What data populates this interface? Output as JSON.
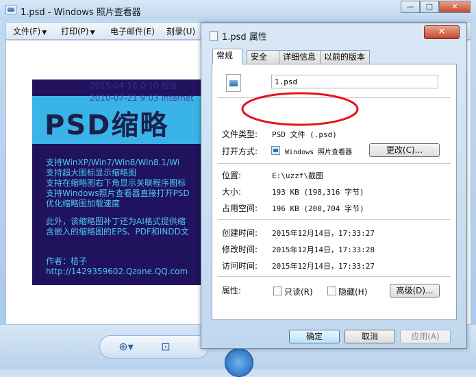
{
  "viewer": {
    "title": "1.psd - Windows 照片查看器",
    "window_buttons": {
      "minimize": "—",
      "maximize": "□",
      "close": "✕"
    },
    "menu": [
      {
        "label": "文件(F)"
      },
      {
        "label": "打印(P)"
      },
      {
        "label": "电子邮件(E)"
      },
      {
        "label": "刻录(U)"
      }
    ],
    "preview": {
      "date1": "2015-04-16 0:10    包含",
      "date2": "2010-07-21 9:03    Internet",
      "big_text": "PSD缩略",
      "lines": [
        "支持WinXP/Win7/Win8/Win8.1/Wi",
        "支持超大图标显示缩略图",
        "支持在缩略图右下角显示关联程序图标",
        "支持Windows照片查看器直接打开PSD",
        "优化缩略图加载速度"
      ],
      "extra": [
        "此外，该缩略图补丁还为AI格式提供缩",
        "含嵌入的缩略图的EPS、PDF和INDD文"
      ],
      "author": [
        "作者：桔子",
        "http://1429359602.Qzone.QQ.com"
      ]
    },
    "controls": {
      "zoom_icon": "zoom-icon",
      "fit_icon": "fit-window-icon"
    }
  },
  "dialog": {
    "title": "1.psd 属性",
    "close_label": "✕",
    "tabs": [
      "常规",
      "安全",
      "详细信息",
      "以前的版本"
    ],
    "filename": "1.psd",
    "rows": {
      "type_label": "文件类型:",
      "type_value": "PSD 文件 (.psd)",
      "opener_label": "打开方式:",
      "opener_value": "Windows 照片查看器",
      "change_button": "更改(C)...",
      "location_label": "位置:",
      "location_value": "E:\\uzzf\\截图",
      "size_label": "大小:",
      "size_value": "193 KB (198,316 字节)",
      "disk_label": "占用空间:",
      "disk_value": "196 KB (200,704 字节)",
      "created_label": "创建时间:",
      "created_value": "2015年12月14日，17:33:27",
      "modified_label": "修改时间:",
      "modified_value": "2015年12月14日，17:33:28",
      "accessed_label": "访问时间:",
      "accessed_value": "2015年12月14日，17:33:27",
      "attr_label": "属性:",
      "readonly_label": "只读(R)",
      "hidden_label": "隐藏(H)",
      "advanced_button": "高级(D)..."
    },
    "buttons": {
      "ok": "确定",
      "cancel": "取消",
      "apply": "应用(A)"
    }
  },
  "colors": {
    "annotation": "#e8111a",
    "preview_bg": "#21125e",
    "preview_band": "#3ab3e8",
    "preview_text": "#48c8f0"
  }
}
